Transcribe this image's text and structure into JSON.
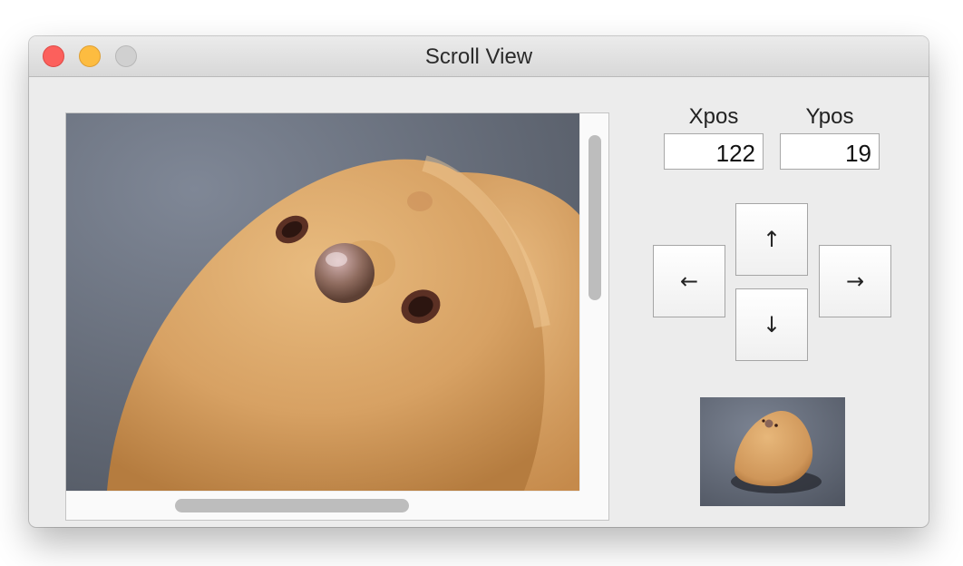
{
  "window": {
    "title": "Scroll View"
  },
  "controls": {
    "xpos_label": "Xpos",
    "ypos_label": "Ypos",
    "xpos_value": "122",
    "ypos_value": "19"
  },
  "buttons": {
    "up": "↑",
    "down": "↓",
    "left": "←",
    "right": "→"
  },
  "icons": {
    "close": "close-traffic-light",
    "minimize": "minimize-traffic-light",
    "zoom": "zoom-traffic-light"
  },
  "colors": {
    "close": "#fc605c",
    "minimize": "#fdbc40",
    "zoom": "#d0d0d0",
    "window_bg": "#ececec"
  }
}
